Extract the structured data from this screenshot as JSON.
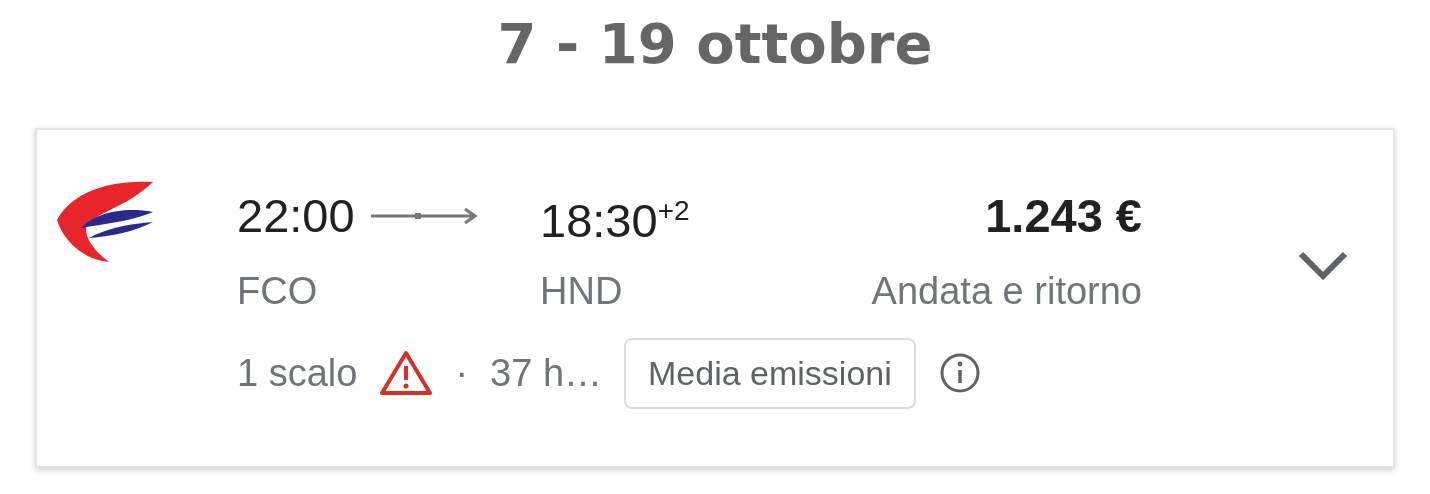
{
  "heading": "7 - 19 ottobre",
  "flight": {
    "departure_time": "22:00",
    "arrival_time": "18:30",
    "day_offset": "+2",
    "departure_airport": "FCO",
    "arrival_airport": "HND",
    "price": "1.243 €",
    "trip_type": "Andata e ritorno",
    "stops": "1 scalo",
    "stop_warning": true,
    "separator": "·",
    "duration": "37 h…",
    "emissions": "Media emissioni",
    "expanded": false
  }
}
